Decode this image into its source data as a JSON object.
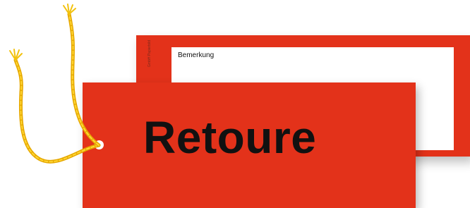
{
  "front_tag": {
    "title": "Retoure",
    "color": "#e3321a"
  },
  "back_tag": {
    "remark_label": "Bemerkung",
    "imprint_text": "GmbH Papierbild",
    "color": "#e3321a"
  },
  "string": {
    "color": "#f2c20f",
    "icon": "twisted-yellow-string"
  }
}
